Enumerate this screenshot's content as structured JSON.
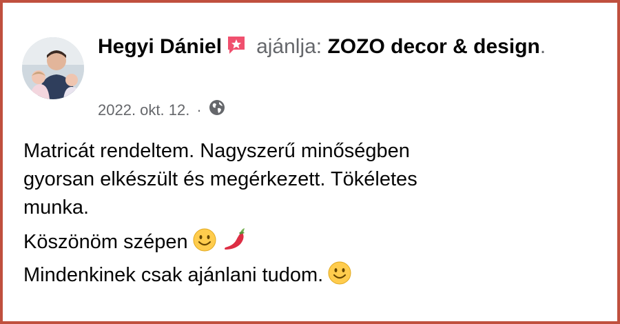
{
  "post": {
    "author_name": "Hegyi Dániel",
    "recommends_text": "ajánlja:",
    "page_name": "ZOZO decor & design",
    "end_punct": ".",
    "date": "2022. okt. 12.",
    "separator": "·",
    "privacy_icon": "globe-icon",
    "badge_icon": "recommendation-badge-icon",
    "review_lines": [
      "Matricát rendeltem. Nagyszerű minőségben",
      "gyorsan elkészült és megérkezett. Tökéletes",
      "munka."
    ],
    "thanks_line": "Köszönöm szépen",
    "closing_line": "Mindenkinek csak ajánlani tudom.",
    "emojis": [
      "smiley-emoji",
      "chili-pepper-emoji",
      "smiley-emoji"
    ]
  },
  "colors": {
    "border": "#c0503e",
    "text": "#050505",
    "secondary_text": "#65676b",
    "badge": "#f0506e"
  }
}
